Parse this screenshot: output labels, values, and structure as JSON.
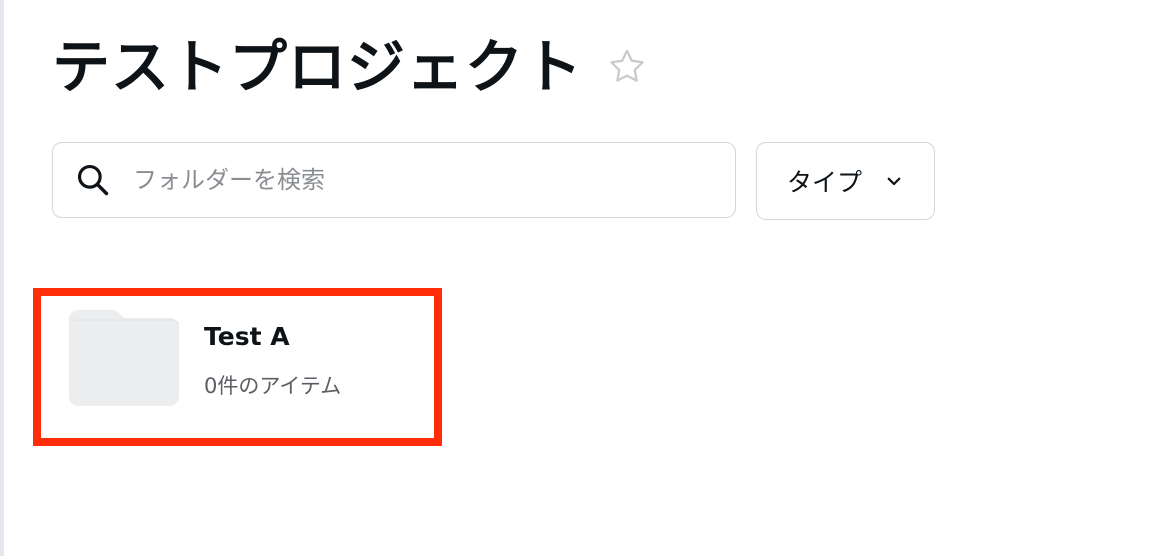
{
  "page": {
    "title": "テストプロジェクト"
  },
  "search": {
    "placeholder": "フォルダーを検索",
    "value": ""
  },
  "filter": {
    "type_label": "タイプ"
  },
  "folders": [
    {
      "name": "Test A",
      "meta": "0件のアイテム"
    }
  ],
  "icons": {
    "favorite": "star-outline-icon",
    "search": "search-icon",
    "dropdown": "chevron-down-icon",
    "folder": "folder-icon"
  },
  "colors": {
    "highlight": "#ff2d08",
    "folder_fill": "#ecedef",
    "text": "#0e1318",
    "border": "#d5d7db"
  }
}
